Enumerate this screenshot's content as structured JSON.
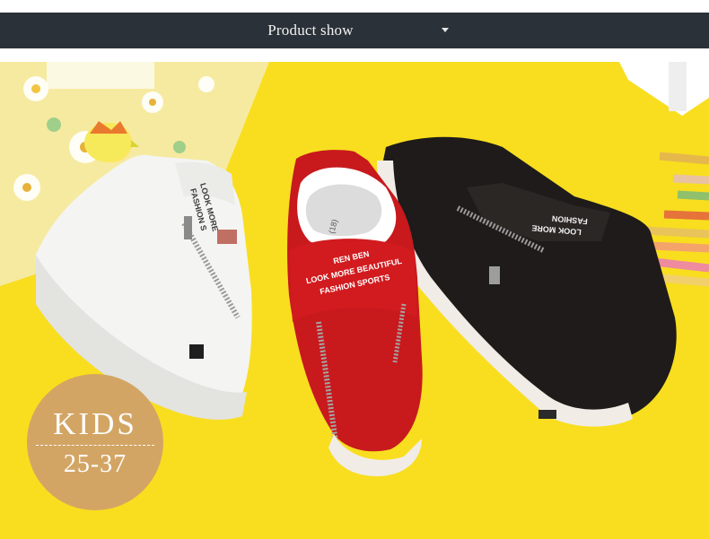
{
  "header": {
    "title": "Product show",
    "dropdown_icon": "caret-down-icon"
  },
  "photo": {
    "alt_subject": "three kids canvas zip sneakers: white, red, black",
    "colors": {
      "background": "#f8de1f",
      "white_shoe": "#f4f4f2",
      "red_shoe": "#c8191d",
      "black_shoe": "#1e1b1a",
      "badge": "#d3a564"
    }
  },
  "shoe_print": {
    "white": [
      "LOOK MORE",
      "FASHION S"
    ],
    "red_lines": [
      "REN BEN",
      "LOOK MORE BEAUTIFUL",
      "FASHION SPORTS"
    ],
    "red_insole": "(18)",
    "black": [
      "FASHION",
      "LOOK MORE"
    ]
  },
  "badge": {
    "kids_label": "KIDS",
    "size_range": "25-37"
  }
}
